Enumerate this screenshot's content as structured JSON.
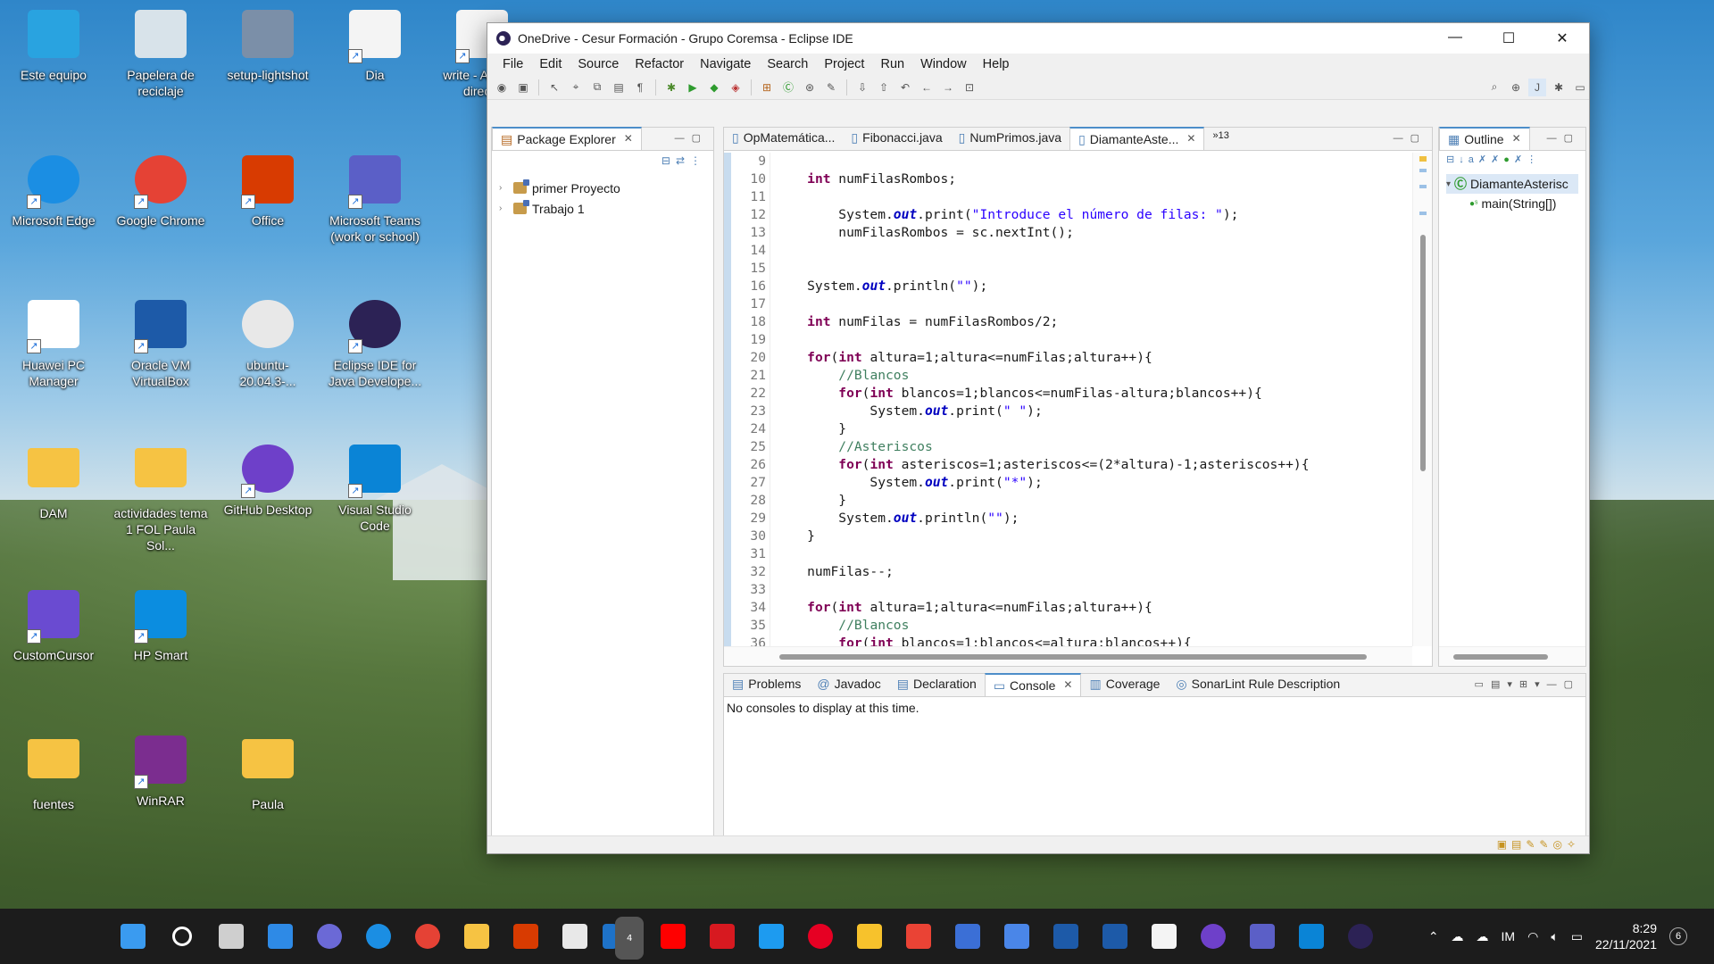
{
  "desktop": {
    "icons": [
      {
        "label": "Este equipo",
        "icon": "computer-icon",
        "color": "#29a3e0",
        "shortcut": false
      },
      {
        "label": "Papelera de reciclaje",
        "icon": "recycle-bin-icon",
        "color": "#d8e3ea",
        "shortcut": false
      },
      {
        "label": "setup-lightshot",
        "icon": "installer-icon",
        "color": "#7b8fa8",
        "shortcut": false
      },
      {
        "label": "Dia",
        "icon": "dia-icon",
        "color": "#f4f4f4",
        "shortcut": true
      },
      {
        "label": "write - Acceso directo",
        "icon": "write-icon",
        "color": "#f4f4f4",
        "shortcut": true
      },
      {
        "label": "Microsoft Edge",
        "icon": "edge-icon",
        "color": "#1b8ee3",
        "shortcut": true
      },
      {
        "label": "Google Chrome",
        "icon": "chrome-icon",
        "color": "#e54235",
        "shortcut": true
      },
      {
        "label": "Office",
        "icon": "office-icon",
        "color": "#d83b01",
        "shortcut": true
      },
      {
        "label": "Microsoft Teams (work or school)",
        "icon": "teams-icon",
        "color": "#5b5fc7",
        "shortcut": true
      },
      {
        "label": "Huawei PC Manager",
        "icon": "huawei-icon",
        "color": "#ffffff",
        "shortcut": true
      },
      {
        "label": "Oracle VM VirtualBox",
        "icon": "virtualbox-icon",
        "color": "#1d5aa8",
        "shortcut": true
      },
      {
        "label": "ubuntu-20.04.3-...",
        "icon": "disc-image-icon",
        "color": "#e8e8e8",
        "shortcut": false
      },
      {
        "label": "Eclipse IDE for Java Develope...",
        "icon": "eclipse-icon",
        "color": "#2c2255",
        "shortcut": true
      },
      {
        "label": "DAM",
        "icon": "folder-icon",
        "color": "#f6c343",
        "shortcut": false
      },
      {
        "label": "actividades tema 1 FOL Paula Sol...",
        "icon": "folder-icon",
        "color": "#f6c343",
        "shortcut": false
      },
      {
        "label": "GitHub Desktop",
        "icon": "github-icon",
        "color": "#6e40c9",
        "shortcut": true
      },
      {
        "label": "Visual Studio Code",
        "icon": "vscode-icon",
        "color": "#0a84d6",
        "shortcut": true
      },
      {
        "label": "CustomCursor",
        "icon": "cursor-icon",
        "color": "#6a4bd1",
        "shortcut": true
      },
      {
        "label": "HP Smart",
        "icon": "hp-smart-icon",
        "color": "#0b8de0",
        "shortcut": true
      },
      {
        "label": "fuentes",
        "icon": "folder-icon",
        "color": "#f6c343",
        "shortcut": false
      },
      {
        "label": "WinRAR",
        "icon": "winrar-icon",
        "color": "#7b2d8f",
        "shortcut": true
      },
      {
        "label": "Paula",
        "icon": "folder-icon",
        "color": "#f6c343",
        "shortcut": false
      }
    ]
  },
  "window": {
    "title": "OneDrive - Cesur Formación - Grupo Coremsa - Eclipse IDE",
    "menu": [
      "File",
      "Edit",
      "Source",
      "Refactor",
      "Navigate",
      "Search",
      "Project",
      "Run",
      "Window",
      "Help"
    ],
    "controls": {
      "minimize": "—",
      "maximize": "☐",
      "close": "✕"
    }
  },
  "package_explorer": {
    "tab": "Package Explorer",
    "items": [
      "primer Proyecto",
      "Trabajo 1"
    ]
  },
  "editor": {
    "tabs": [
      "OpMatemática...",
      "Fibonacci.java",
      "NumPrimos.java",
      "DiamanteAste..."
    ],
    "active_tab": 3,
    "overflow": "»13",
    "lines": [
      {
        "n": "9",
        "segs": []
      },
      {
        "n": "10",
        "segs": [
          [
            "    ",
            ""
          ],
          [
            "int",
            "kw"
          ],
          [
            " numFilasRombos;",
            ""
          ]
        ]
      },
      {
        "n": "11",
        "segs": []
      },
      {
        "n": "12",
        "segs": [
          [
            "        System.",
            ""
          ],
          [
            "out",
            "fld"
          ],
          [
            ".print(",
            ""
          ],
          [
            "\"Introduce el número de filas: \"",
            "str"
          ],
          [
            ");",
            ""
          ]
        ]
      },
      {
        "n": "13",
        "segs": [
          [
            "        numFilasRombos = sc.nextInt();",
            ""
          ]
        ]
      },
      {
        "n": "14",
        "segs": []
      },
      {
        "n": "15",
        "segs": []
      },
      {
        "n": "16",
        "segs": [
          [
            "    System.",
            ""
          ],
          [
            "out",
            "fld"
          ],
          [
            ".println(",
            ""
          ],
          [
            "\"\"",
            "str"
          ],
          [
            ");",
            ""
          ]
        ]
      },
      {
        "n": "17",
        "segs": []
      },
      {
        "n": "18",
        "segs": [
          [
            "    ",
            ""
          ],
          [
            "int",
            "kw"
          ],
          [
            " numFilas = numFilasRombos/2;",
            ""
          ]
        ]
      },
      {
        "n": "19",
        "segs": []
      },
      {
        "n": "20",
        "segs": [
          [
            "    ",
            ""
          ],
          [
            "for",
            "kw"
          ],
          [
            "(",
            ""
          ],
          [
            "int",
            "kw"
          ],
          [
            " altura=1;altura<=numFilas;altura++){",
            ""
          ]
        ]
      },
      {
        "n": "21",
        "segs": [
          [
            "        ",
            ""
          ],
          [
            "//Blancos",
            "cm"
          ]
        ]
      },
      {
        "n": "22",
        "segs": [
          [
            "        ",
            ""
          ],
          [
            "for",
            "kw"
          ],
          [
            "(",
            ""
          ],
          [
            "int",
            "kw"
          ],
          [
            " blancos=1;blancos<=numFilas-altura;blancos++){",
            ""
          ]
        ]
      },
      {
        "n": "23",
        "segs": [
          [
            "            System.",
            ""
          ],
          [
            "out",
            "fld"
          ],
          [
            ".print(",
            ""
          ],
          [
            "\" \"",
            "str"
          ],
          [
            ");",
            ""
          ]
        ]
      },
      {
        "n": "24",
        "segs": [
          [
            "        }",
            ""
          ]
        ]
      },
      {
        "n": "25",
        "segs": [
          [
            "        ",
            ""
          ],
          [
            "//Asteriscos",
            "cm"
          ]
        ]
      },
      {
        "n": "26",
        "segs": [
          [
            "        ",
            ""
          ],
          [
            "for",
            "kw"
          ],
          [
            "(",
            ""
          ],
          [
            "int",
            "kw"
          ],
          [
            " asteriscos=1;asteriscos<=(2*altura)-1;asteriscos++){",
            ""
          ]
        ]
      },
      {
        "n": "27",
        "segs": [
          [
            "            System.",
            ""
          ],
          [
            "out",
            "fld"
          ],
          [
            ".print(",
            ""
          ],
          [
            "\"*\"",
            "str"
          ],
          [
            ");",
            ""
          ]
        ]
      },
      {
        "n": "28",
        "segs": [
          [
            "        }",
            ""
          ]
        ]
      },
      {
        "n": "29",
        "segs": [
          [
            "        System.",
            ""
          ],
          [
            "out",
            "fld"
          ],
          [
            ".println(",
            ""
          ],
          [
            "\"\"",
            "str"
          ],
          [
            ");",
            ""
          ]
        ]
      },
      {
        "n": "30",
        "segs": [
          [
            "    }",
            ""
          ]
        ]
      },
      {
        "n": "31",
        "segs": []
      },
      {
        "n": "32",
        "segs": [
          [
            "    numFilas--;",
            ""
          ]
        ]
      },
      {
        "n": "33",
        "segs": []
      },
      {
        "n": "34",
        "segs": [
          [
            "    ",
            ""
          ],
          [
            "for",
            "kw"
          ],
          [
            "(",
            ""
          ],
          [
            "int",
            "kw"
          ],
          [
            " altura=1;altura<=numFilas;altura++){",
            ""
          ]
        ]
      },
      {
        "n": "35",
        "segs": [
          [
            "        ",
            ""
          ],
          [
            "//Blancos",
            "cm"
          ]
        ]
      },
      {
        "n": "36",
        "segs": [
          [
            "        ",
            ""
          ],
          [
            "for",
            "kw"
          ],
          [
            "(",
            ""
          ],
          [
            "int",
            "kw"
          ],
          [
            " blancos=1;blancos<=altura;blancos++){",
            ""
          ]
        ]
      }
    ]
  },
  "outline": {
    "tab": "Outline",
    "items": [
      "DiamanteAsterisc",
      "main(String[])"
    ]
  },
  "console": {
    "tabs": [
      "Problems",
      "Javadoc",
      "Declaration",
      "Console",
      "Coverage",
      "SonarLint Rule Description"
    ],
    "active_tab": 3,
    "message": "No consoles to display at this time."
  },
  "taskbar": {
    "apps": [
      {
        "name": "start-icon",
        "color": "#3a9bf0"
      },
      {
        "name": "search-icon",
        "color": "#ffffff"
      },
      {
        "name": "task-view-icon",
        "color": "#cfcfcf"
      },
      {
        "name": "widgets-icon",
        "color": "#2e8ae6"
      },
      {
        "name": "chat-icon",
        "color": "#6b69d6"
      },
      {
        "name": "edge-icon",
        "color": "#1b8ee3"
      },
      {
        "name": "chrome-icon",
        "color": "#e54235"
      },
      {
        "name": "file-explorer-icon",
        "color": "#f6c343"
      },
      {
        "name": "office-icon",
        "color": "#d83b01"
      },
      {
        "name": "store-icon",
        "color": "#e8e8e8"
      },
      {
        "name": "mail-icon",
        "color": "#1e72c8"
      },
      {
        "name": "youtube-icon",
        "color": "#ff0000"
      },
      {
        "name": "pdf-icon",
        "color": "#d71920"
      },
      {
        "name": "twitter-icon",
        "color": "#1d9bf0"
      },
      {
        "name": "pinterest-icon",
        "color": "#e60023"
      },
      {
        "name": "sticky-notes-icon",
        "color": "#f7c22c"
      },
      {
        "name": "gmail-icon",
        "color": "#ea4335"
      },
      {
        "name": "c-app-icon",
        "color": "#3b6fd6"
      },
      {
        "name": "docs-icon",
        "color": "#4a86e8"
      },
      {
        "name": "virtualbox-icon",
        "color": "#1d5aa8"
      },
      {
        "name": "virtualbox-2-icon",
        "color": "#1d5aa8"
      },
      {
        "name": "dia-icon",
        "color": "#f4f4f4"
      },
      {
        "name": "github-icon",
        "color": "#6e40c9"
      },
      {
        "name": "teams-icon",
        "color": "#5b5fc7"
      },
      {
        "name": "vscode-icon",
        "color": "#0a84d6"
      },
      {
        "name": "eclipse-icon",
        "color": "#2c2255"
      }
    ],
    "mail_badge": "4",
    "time": "8:29",
    "date": "22/11/2021",
    "notification_count": "6"
  }
}
